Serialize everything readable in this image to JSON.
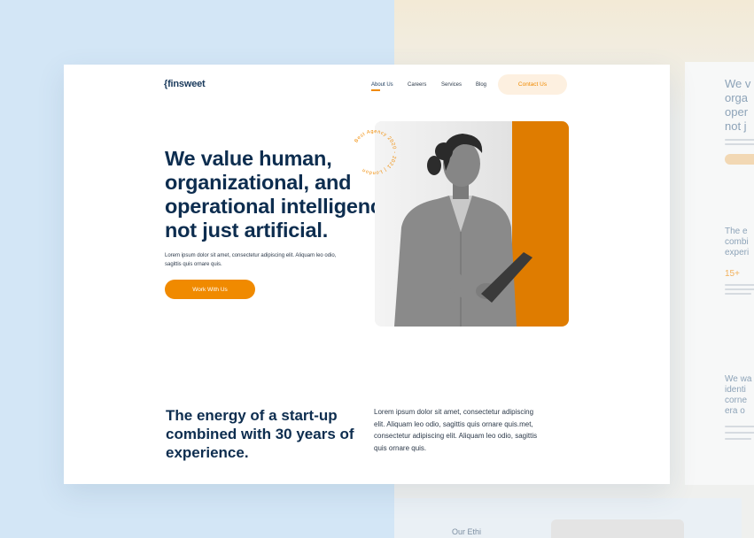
{
  "nav": {
    "logo": "{finsweet",
    "items": [
      "About Us",
      "Careers",
      "Services",
      "Blog"
    ],
    "active": "About Us",
    "cta": "Contact Us"
  },
  "hero": {
    "title_lines": [
      "We value human,",
      "organizational, and",
      "operational intelligence",
      "not just artificial."
    ],
    "paragraph": "Lorem ipsum dolor sit amet, consectetur adipiscing elit. Aliquam leo odio, sagittis quis ornare quis.",
    "button": "Work With Us",
    "badge_text": "Best Agency 2020 - 2021 | London"
  },
  "section2": {
    "title_lines": [
      "The energy of a start-up",
      "combined with 30 years of",
      "experience."
    ],
    "paragraph_lines": [
      "Lorem ipsum dolor sit amet, consectetur adipiscing",
      "elit. Aliquam leo odio, sagittis quis ornare quis.met,",
      "consectetur adipiscing elit. Aliquam leo odio, sagittis",
      "quis ornare quis."
    ]
  },
  "side_preview": {
    "heading1_lines": [
      "We v",
      "orga",
      "oper",
      "not j"
    ],
    "heading2_lines": [
      "The e",
      "combi",
      "experi"
    ],
    "stat": "15+",
    "heading3_lines": [
      "We wa",
      "identi",
      "corne",
      "era o"
    ],
    "bottom_text": "Our Ethi"
  },
  "colors": {
    "accent": "#f08a00",
    "navy": "#0d2d4f",
    "bg_left": "#d3e6f6",
    "bg_right": "#eff0ee"
  }
}
